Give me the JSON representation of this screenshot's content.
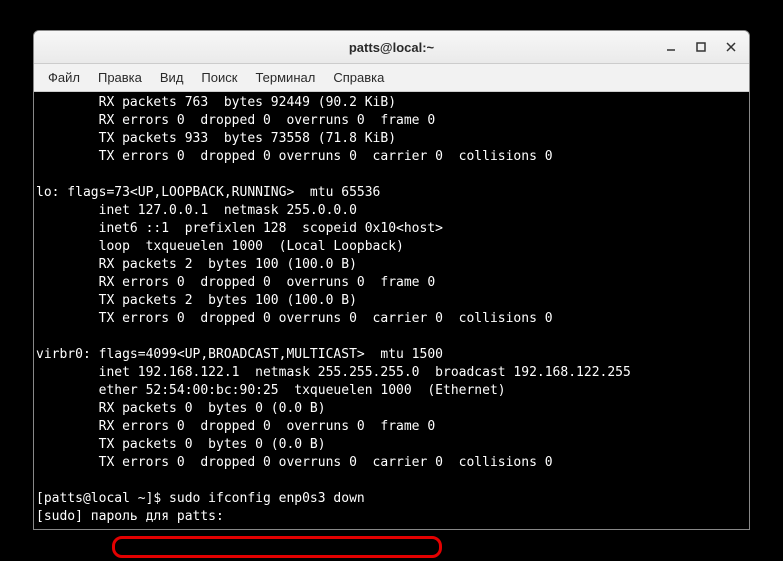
{
  "window": {
    "title": "patts@local:~"
  },
  "menubar": {
    "items": [
      "Файл",
      "Правка",
      "Вид",
      "Поиск",
      "Терминал",
      "Справка"
    ]
  },
  "terminal": {
    "lines": [
      "        RX packets 763  bytes 92449 (90.2 KiB)",
      "        RX errors 0  dropped 0  overruns 0  frame 0",
      "        TX packets 933  bytes 73558 (71.8 KiB)",
      "        TX errors 0  dropped 0 overruns 0  carrier 0  collisions 0",
      "",
      "lo: flags=73<UP,LOOPBACK,RUNNING>  mtu 65536",
      "        inet 127.0.0.1  netmask 255.0.0.0",
      "        inet6 ::1  prefixlen 128  scopeid 0x10<host>",
      "        loop  txqueuelen 1000  (Local Loopback)",
      "        RX packets 2  bytes 100 (100.0 B)",
      "        RX errors 0  dropped 0  overruns 0  frame 0",
      "        TX packets 2  bytes 100 (100.0 B)",
      "        TX errors 0  dropped 0 overruns 0  carrier 0  collisions 0",
      "",
      "virbr0: flags=4099<UP,BROADCAST,MULTICAST>  mtu 1500",
      "        inet 192.168.122.1  netmask 255.255.255.0  broadcast 192.168.122.255",
      "        ether 52:54:00:bc:90:25  txqueuelen 1000  (Ethernet)",
      "        RX packets 0  bytes 0 (0.0 B)",
      "        RX errors 0  dropped 0  overruns 0  frame 0",
      "        TX packets 0  bytes 0 (0.0 B)",
      "        TX errors 0  dropped 0 overruns 0  carrier 0  collisions 0",
      "",
      "[patts@local ~]$ sudo ifconfig enp0s3 down",
      "[sudo] пароль для patts: "
    ]
  }
}
